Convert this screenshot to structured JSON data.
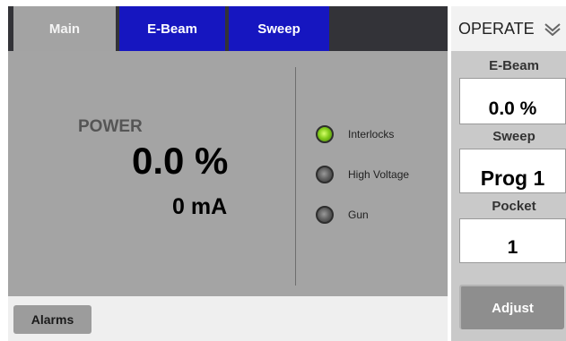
{
  "tabs": [
    {
      "label": "Main",
      "active": true
    },
    {
      "label": "E-Beam",
      "active": false
    },
    {
      "label": "Sweep",
      "active": false
    }
  ],
  "main": {
    "power_label": "POWER",
    "power_percent": "0.0 %",
    "power_current": "0 mA",
    "indicators": [
      {
        "label": "Interlocks",
        "state": "on",
        "color": "#84cc1c"
      },
      {
        "label": "High Voltage",
        "state": "off",
        "color": "#5f5f5f"
      },
      {
        "label": "Gun",
        "state": "off",
        "color": "#5f5f5f"
      }
    ]
  },
  "bottom": {
    "alarms_label": "Alarms"
  },
  "right_panel": {
    "mode_label": "OPERATE",
    "ebeam_label": "E-Beam",
    "ebeam_value": "0.0 %",
    "sweep_label": "Sweep",
    "sweep_value": "Prog 1",
    "pocket_label": "Pocket",
    "pocket_value": "1",
    "adjust_label": "Adjust"
  },
  "colors": {
    "tab_active": "#a3a3a3",
    "tab_inactive": "#1616c0",
    "panel": "#a4a4a4",
    "frame": "#333338"
  }
}
